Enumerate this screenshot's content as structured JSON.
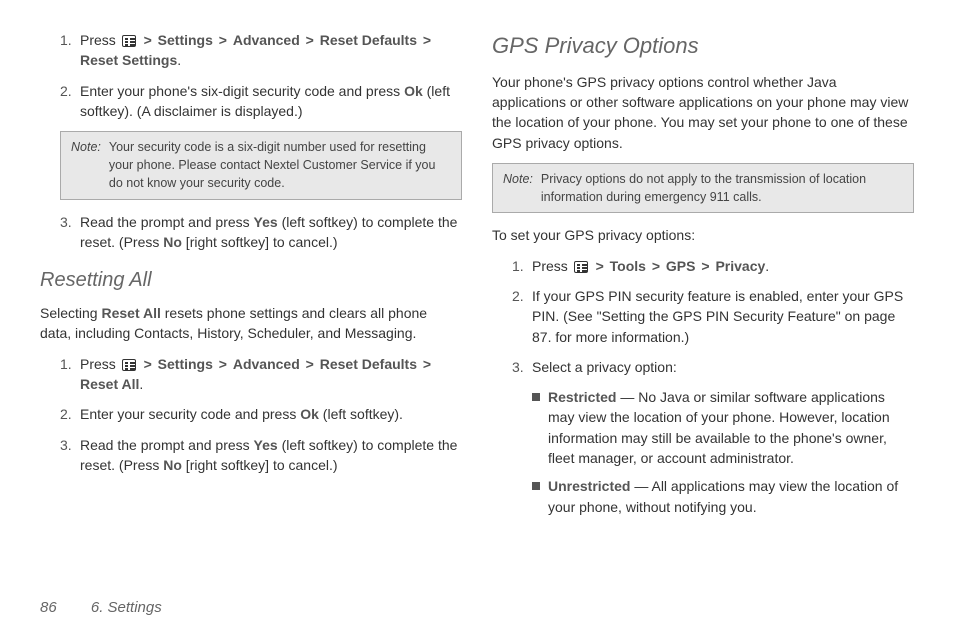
{
  "left": {
    "step1": {
      "num": "1.",
      "pre": "Press ",
      "path": [
        "Settings",
        "Advanced",
        "Reset Defaults",
        "Reset Settings"
      ],
      "post": "."
    },
    "step2": {
      "num": "2.",
      "pre": "Enter your phone's six-digit security code and press ",
      "ok": "Ok",
      "post": " (left softkey). (A disclaimer is displayed.)"
    },
    "note": {
      "label": "Note:",
      "text": "Your security code is a six-digit number used for resetting your phone. Please contact Nextel Customer Service if you do not know your security code."
    },
    "step3": {
      "num": "3.",
      "pre": "Read the prompt and press ",
      "yes": "Yes",
      "mid": " (left softkey) to complete the reset. (Press ",
      "no": "No",
      "post": " [right softkey] to cancel.)"
    },
    "heading": "Resetting All",
    "para_a": "Selecting ",
    "para_bold": "Reset All",
    "para_b": " resets phone settings and clears all phone data, including Contacts, History, Scheduler, and Messaging.",
    "rstep1": {
      "num": "1.",
      "pre": "Press ",
      "path": [
        "Settings",
        "Advanced",
        "Reset Defaults",
        "Reset All"
      ],
      "post": "."
    },
    "rstep2": {
      "num": "2.",
      "pre": "Enter your security code and press ",
      "ok": "Ok",
      "post": " (left softkey)."
    },
    "rstep3": {
      "num": "3.",
      "pre": "Read the prompt and press ",
      "yes": "Yes",
      "mid": " (left softkey) to complete the reset. (Press ",
      "no": "No",
      "post": " [right softkey] to cancel.)"
    }
  },
  "right": {
    "heading": "GPS Privacy Options",
    "intro": "Your phone's GPS privacy options control whether Java applications or other software applications on your phone may view the location of your phone. You may set your phone to one of these GPS privacy options.",
    "note": {
      "label": "Note:",
      "text": "Privacy options do not apply to the transmission of location information during emergency 911 calls."
    },
    "lead": "To set your GPS privacy options:",
    "step1": {
      "num": "1.",
      "pre": "Press ",
      "path": [
        "Tools",
        "GPS",
        "Privacy"
      ],
      "post": "."
    },
    "step2": {
      "num": "2.",
      "text": "If your GPS PIN security feature is enabled, enter your GPS PIN. (See \"Setting the GPS PIN Security Feature\" on page 87. for more information.)"
    },
    "step3": {
      "num": "3.",
      "text": "Select a privacy option:"
    },
    "opt1": {
      "name": "Restricted",
      "text": " — No Java or similar software applications may view the location of your phone. However, location information may still be available to the phone's owner, fleet manager, or account administrator."
    },
    "opt2": {
      "name": "Unrestricted",
      "text": " — All applications may view the location of your phone, without notifying you."
    }
  },
  "footer": {
    "page": "86",
    "chapter": "6. Settings"
  },
  "gt": ">"
}
